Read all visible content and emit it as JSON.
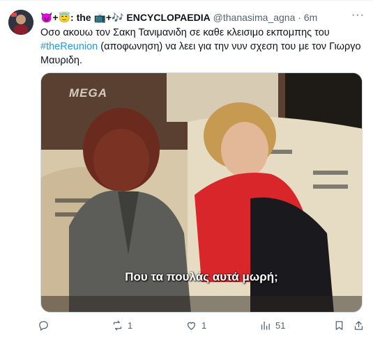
{
  "tweet": {
    "name_emoji": "😈+😇",
    "name_part1": ": the ",
    "name_emoji2": "📺+🎶",
    "name_part2": " ENCYCLOPAEDIA",
    "handle": "@thanasima_agna",
    "separator": "·",
    "time": "6m",
    "more_icon": "ellipsis-icon",
    "text_before": "Οσο ακουω τον Σακη Τανιμανιδη σε καθε κλεισιμο εκπομπης του ",
    "hashtag": "#theReunion",
    "text_after": " (αποφωνηση) να λεει για την νυν σχεση του με τον Γιωργο Μαυριδη.",
    "media": {
      "logo": "MEGA",
      "subtitle": "Που τα πουλάς αυτά μωρή;"
    },
    "actions": {
      "reply_count": "",
      "retweet_count": "1",
      "like_count": "1",
      "views_count": "51"
    }
  },
  "colors": {
    "accent": "#1d9bf0",
    "secondary_text": "#536471"
  }
}
